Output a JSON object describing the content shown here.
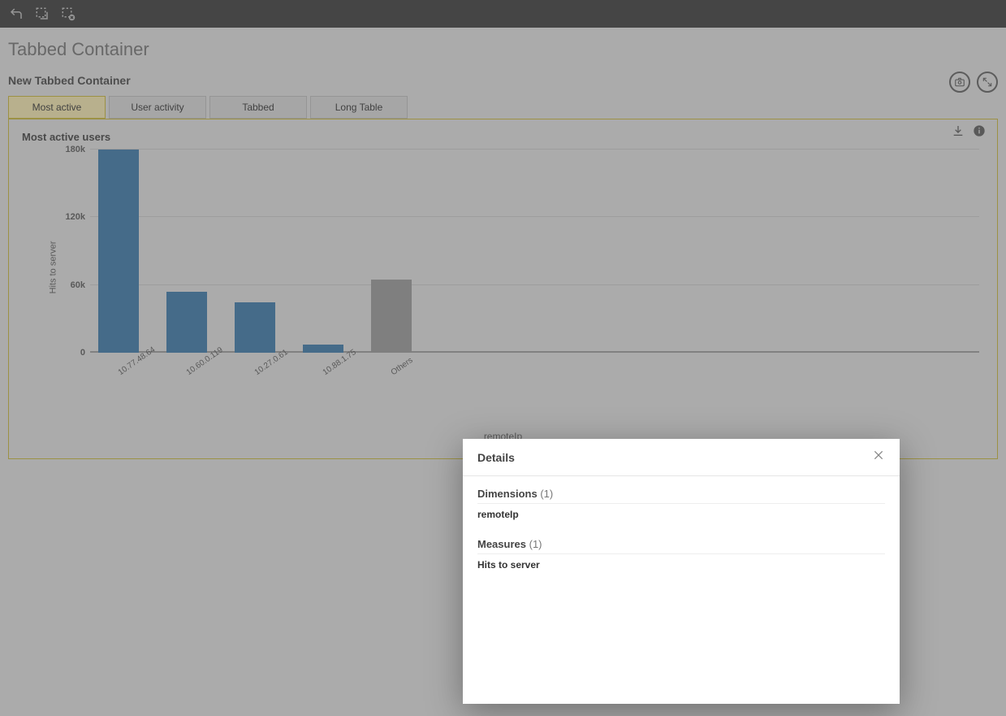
{
  "page_title": "Tabbed Container",
  "subtitle": "New Tabbed Container",
  "tabs": [
    {
      "label": "Most active",
      "active": true
    },
    {
      "label": "User activity",
      "active": false
    },
    {
      "label": "Tabbed",
      "active": false
    },
    {
      "label": "Long Table",
      "active": false
    }
  ],
  "panel": {
    "title": "Most active users"
  },
  "chart_data": {
    "type": "bar",
    "title": "Most active users",
    "xlabel": "remoteIp",
    "ylabel": "Hits to server",
    "ylim": [
      0,
      180000
    ],
    "ticks": [
      "0",
      "60k",
      "120k",
      "180k"
    ],
    "categories": [
      "10.77.48.64",
      "10.60.0.119",
      "10.27.0.61",
      "10.88.1.75",
      "Others"
    ],
    "values": [
      180000,
      54000,
      45000,
      7000,
      65000
    ],
    "other_index": 4,
    "colors": {
      "bar": "#3a6e98",
      "other": "#8a8a8a"
    }
  },
  "modal": {
    "title": "Details",
    "dimensions_label": "Dimensions",
    "dimensions_count": "(1)",
    "dimensions_item": "remoteIp",
    "measures_label": "Measures",
    "measures_count": "(1)",
    "measures_item": "Hits to server"
  }
}
